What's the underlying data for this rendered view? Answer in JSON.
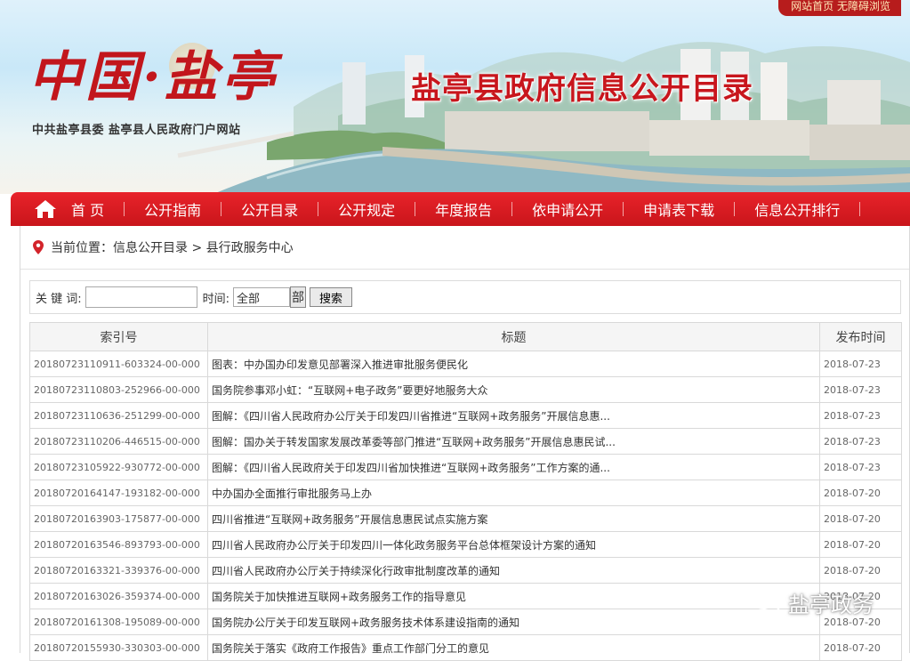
{
  "top_links": {
    "home": "网站首页",
    "accessible": "无障碍浏览"
  },
  "logo": {
    "china": "中国",
    "dot": "·",
    "county": "盐亭",
    "subtitle": "中共盐亭县委 盐亭县人民政府门户网站"
  },
  "banner_title": "盐亭县政府信息公开目录",
  "nav": {
    "items": [
      "首 页",
      "公开指南",
      "公开目录",
      "公开规定",
      "年度报告",
      "依申请公开",
      "申请表下载",
      "信息公开排行"
    ]
  },
  "breadcrumb": {
    "prefix": "当前位置：",
    "path": "信息公开目录 > 县行政服务中心"
  },
  "search": {
    "keyword_label": "关 键 词:",
    "keyword_value": "",
    "time_label": "时间:",
    "time_value": "全部",
    "time_button": "部",
    "submit": "搜索"
  },
  "table": {
    "headers": {
      "index": "索引号",
      "title": "标题",
      "date": "发布时间"
    },
    "rows": [
      {
        "index": "20180723110911-603324-00-000",
        "title": "图表：中办国办印发意见部署深入推进审批服务便民化",
        "date": "2018-07-23"
      },
      {
        "index": "20180723110803-252966-00-000",
        "title": "国务院参事邓小虹：“互联网+电子政务”要更好地服务大众",
        "date": "2018-07-23"
      },
      {
        "index": "20180723110636-251299-00-000",
        "title": "图解：《四川省人民政府办公厅关于印发四川省推进“互联网+政务服务”开展信息惠...",
        "date": "2018-07-23"
      },
      {
        "index": "20180723110206-446515-00-000",
        "title": "图解：国办关于转发国家发展改革委等部门推进“互联网+政务服务”开展信息惠民试...",
        "date": "2018-07-23"
      },
      {
        "index": "20180723105922-930772-00-000",
        "title": "图解：《四川省人民政府关于印发四川省加快推进“互联网+政务服务”工作方案的通...",
        "date": "2018-07-23"
      },
      {
        "index": "20180720164147-193182-00-000",
        "title": "中办国办全面推行审批服务马上办",
        "date": "2018-07-20"
      },
      {
        "index": "20180720163903-175877-00-000",
        "title": "四川省推进“互联网+政务服务”开展信息惠民试点实施方案",
        "date": "2018-07-20"
      },
      {
        "index": "20180720163546-893793-00-000",
        "title": "四川省人民政府办公厅关于印发四川一体化政务服务平台总体框架设计方案的通知",
        "date": "2018-07-20"
      },
      {
        "index": "20180720163321-339376-00-000",
        "title": "四川省人民政府办公厅关于持续深化行政审批制度改革的通知",
        "date": "2018-07-20"
      },
      {
        "index": "20180720163026-359374-00-000",
        "title": "国务院关于加快推进互联网+政务服务工作的指导意见",
        "date": "2018-07-20"
      },
      {
        "index": "20180720161308-195089-00-000",
        "title": "国务院办公厅关于印发互联网+政务服务技术体系建设指南的通知",
        "date": "2018-07-20"
      },
      {
        "index": "20180720155930-330303-00-000",
        "title": "国务院关于落实《政府工作报告》重点工作部门分工的意见",
        "date": "2018-07-20"
      }
    ]
  },
  "watermark": "盐亭政务",
  "colors": {
    "brand_red": "#c9151b",
    "nav_red": "#e8232a",
    "title_red": "#c8161d"
  }
}
